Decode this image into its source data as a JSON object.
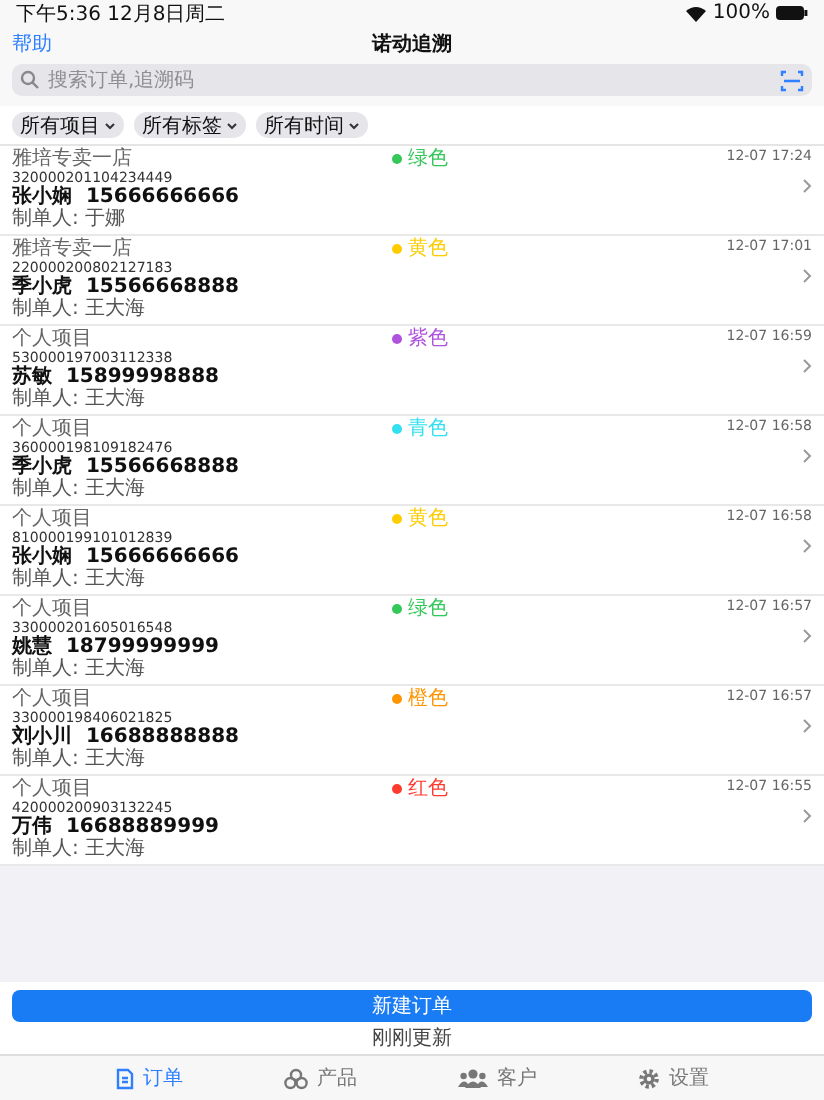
{
  "status_bar": {
    "time": "下午5:36  12月8日周二",
    "battery": "100%"
  },
  "nav": {
    "left": "帮助",
    "title": "诺动追溯"
  },
  "search": {
    "placeholder": "搜索订单,追溯码"
  },
  "filters": [
    "所有项目",
    "所有标签",
    "所有时间"
  ],
  "orders": [
    {
      "project": "雅培专卖一店",
      "code": "320000201104234449",
      "name": "张小娴",
      "phone": "15666666666",
      "maker": "制单人: 于娜",
      "tag": "绿色",
      "color": "#34c759",
      "time": "12-07 17:24"
    },
    {
      "project": "雅培专卖一店",
      "code": "220000200802127183",
      "name": "季小虎",
      "phone": "15566668888",
      "maker": "制单人: 王大海",
      "tag": "黄色",
      "color": "#ffcc00",
      "time": "12-07 17:01"
    },
    {
      "project": "个人项目",
      "code": "530000197003112338",
      "name": "苏敏",
      "phone": "15899998888",
      "maker": "制单人: 王大海",
      "tag": "紫色",
      "color": "#af52de",
      "time": "12-07 16:59"
    },
    {
      "project": "个人项目",
      "code": "360000198109182476",
      "name": "季小虎",
      "phone": "15566668888",
      "maker": "制单人: 王大海",
      "tag": "青色",
      "color": "#32e0f0",
      "time": "12-07 16:58"
    },
    {
      "project": "个人项目",
      "code": "810000199101012839",
      "name": "张小娴",
      "phone": "15666666666",
      "maker": "制单人: 王大海",
      "tag": "黄色",
      "color": "#ffcc00",
      "time": "12-07 16:58"
    },
    {
      "project": "个人项目",
      "code": "330000201605016548",
      "name": "姚慧",
      "phone": "18799999999",
      "maker": "制单人: 王大海",
      "tag": "绿色",
      "color": "#34c759",
      "time": "12-07 16:57"
    },
    {
      "project": "个人项目",
      "code": "330000198406021825",
      "name": "刘小川",
      "phone": "16688888888",
      "maker": "制单人: 王大海",
      "tag": "橙色",
      "color": "#ff9500",
      "time": "12-07 16:57"
    },
    {
      "project": "个人项目",
      "code": "420000200903132245",
      "name": "万伟",
      "phone": "16688889999",
      "maker": "制单人: 王大海",
      "tag": "红色",
      "color": "#ff3b30",
      "time": "12-07 16:55"
    }
  ],
  "new_order_button": "新建订单",
  "update_status": "刚刚更新",
  "tabs": [
    {
      "kind": "orders",
      "label": "订单",
      "selected": true
    },
    {
      "kind": "products",
      "label": "产品",
      "selected": false
    },
    {
      "kind": "customers",
      "label": "客户",
      "selected": false
    },
    {
      "kind": "settings",
      "label": "设置",
      "selected": false
    }
  ]
}
